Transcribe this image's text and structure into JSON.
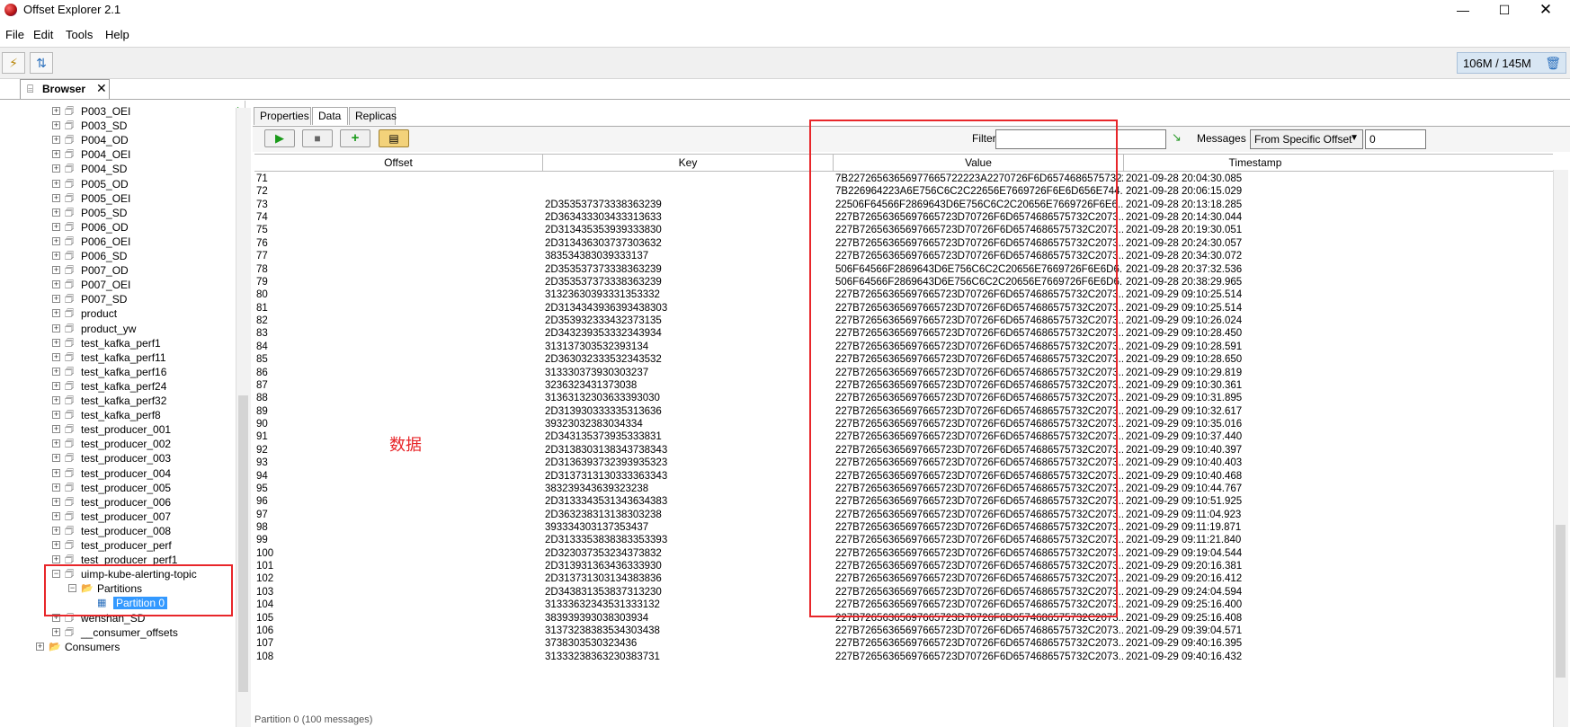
{
  "window": {
    "title": "Offset Explorer  2.1",
    "controls": [
      "—",
      "☐",
      "✕"
    ]
  },
  "menu": [
    "File",
    "Edit",
    "Tools",
    "Help"
  ],
  "memory": "106M / 145M",
  "browser_tab": {
    "label": "Browser",
    "close": "✕"
  },
  "tree": [
    {
      "label": "P003_OEI",
      "level": 1
    },
    {
      "label": "P003_SD",
      "level": 1
    },
    {
      "label": "P004_OD",
      "level": 1
    },
    {
      "label": "P004_OEI",
      "level": 1
    },
    {
      "label": "P004_SD",
      "level": 1
    },
    {
      "label": "P005_OD",
      "level": 1
    },
    {
      "label": "P005_OEI",
      "level": 1
    },
    {
      "label": "P005_SD",
      "level": 1
    },
    {
      "label": "P006_OD",
      "level": 1
    },
    {
      "label": "P006_OEI",
      "level": 1
    },
    {
      "label": "P006_SD",
      "level": 1
    },
    {
      "label": "P007_OD",
      "level": 1
    },
    {
      "label": "P007_OEI",
      "level": 1
    },
    {
      "label": "P007_SD",
      "level": 1
    },
    {
      "label": "product",
      "level": 1
    },
    {
      "label": "product_yw",
      "level": 1
    },
    {
      "label": "test_kafka_perf1",
      "level": 1
    },
    {
      "label": "test_kafka_perf11",
      "level": 1
    },
    {
      "label": "test_kafka_perf16",
      "level": 1
    },
    {
      "label": "test_kafka_perf24",
      "level": 1
    },
    {
      "label": "test_kafka_perf32",
      "level": 1
    },
    {
      "label": "test_kafka_perf8",
      "level": 1
    },
    {
      "label": "test_producer_001",
      "level": 1
    },
    {
      "label": "test_producer_002",
      "level": 1
    },
    {
      "label": "test_producer_003",
      "level": 1
    },
    {
      "label": "test_producer_004",
      "level": 1
    },
    {
      "label": "test_producer_005",
      "level": 1
    },
    {
      "label": "test_producer_006",
      "level": 1
    },
    {
      "label": "test_producer_007",
      "level": 1
    },
    {
      "label": "test_producer_008",
      "level": 1
    },
    {
      "label": "test_producer_perf",
      "level": 1
    },
    {
      "label": "test_producer_perf1",
      "level": 1
    },
    {
      "label": "uimp-kube-alerting-topic",
      "level": 1,
      "expanded": true
    },
    {
      "label": "Partitions",
      "level": 2,
      "expanded": true,
      "folder": true
    },
    {
      "label": "Partition 0",
      "level": 3,
      "selected": true,
      "leaf": true
    },
    {
      "label": "wenshan_SD",
      "level": 1
    },
    {
      "label": "__consumer_offsets",
      "level": 1
    },
    {
      "label": "Consumers",
      "level": 0,
      "folder": true
    }
  ],
  "data_panel": {
    "tabs": [
      "Properties",
      "Data",
      "Replicas"
    ],
    "active_tab": "Data",
    "filter_label": "Filter",
    "filter_value": "",
    "messages_label": "Messages",
    "messages_mode": "From Specific Offset",
    "offset_value": "0",
    "annotation": "数据",
    "status_text": "Partition 0 (100 messages)",
    "columns": [
      "Offset",
      "Key",
      "Value",
      "Timestamp"
    ],
    "rows": [
      [
        "71",
        "",
        "7B22726563656977665722223A2270726F6D657468657573222...",
        "2021-09-28 20:04:30.085"
      ],
      [
        "72",
        "",
        "7B226964223A6E756C6C2C22656E7669726F6E6D656E744...",
        "2021-09-28 20:06:15.029"
      ],
      [
        "73",
        "2D353537373338363239",
        "22506F64566F2869643D6E756C6C2C20656E7669726F6E6...",
        "2021-09-28 20:13:18.285"
      ],
      [
        "74",
        "2D363433303433313633",
        "227B72656365697665723D70726F6D6574686575732C2073...",
        "2021-09-28 20:14:30.044"
      ],
      [
        "75",
        "2D313435353939333830",
        "227B72656365697665723D70726F6D6574686575732C2073...",
        "2021-09-28 20:19:30.051"
      ],
      [
        "76",
        "2D313436303737303632",
        "227B72656365697665723D70726F6D6574686575732C2073...",
        "2021-09-28 20:24:30.057"
      ],
      [
        "77",
        "383534383039333137",
        "227B72656365697665723D70726F6D6574686575732C2073...",
        "2021-09-28 20:34:30.072"
      ],
      [
        "78",
        "2D353537373338363239",
        "506F64566F2869643D6E756C6C2C20656E7669726F6E6D6...",
        "2021-09-28 20:37:32.536"
      ],
      [
        "79",
        "2D353537373338363239",
        "506F64566F2869643D6E756C6C2C20656E7669726F6E6D6...",
        "2021-09-28 20:38:29.965"
      ],
      [
        "80",
        "31323630393331353332",
        "227B72656365697665723D70726F6D6574686575732C2073...",
        "2021-09-29 09:10:25.514"
      ],
      [
        "81",
        "2D3134343936393438303",
        "227B72656365697665723D70726F6D6574686575732C2073...",
        "2021-09-29 09:10:25.514"
      ],
      [
        "82",
        "2D353932333432373135",
        "227B72656365697665723D70726F6D6574686575732C2073...",
        "2021-09-29 09:10:26.024"
      ],
      [
        "83",
        "2D343239353332343934",
        "227B72656365697665723D70726F6D6574686575732C2073...",
        "2021-09-29 09:10:28.450"
      ],
      [
        "84",
        "313137303532393134",
        "227B72656365697665723D70726F6D6574686575732C2073...",
        "2021-09-29 09:10:28.591"
      ],
      [
        "85",
        "2D363032333532343532",
        "227B72656365697665723D70726F6D6574686575732C2073...",
        "2021-09-29 09:10:28.650"
      ],
      [
        "86",
        "313330373930303237",
        "227B72656365697665723D70726F6D6574686575732C2073...",
        "2021-09-29 09:10:29.819"
      ],
      [
        "87",
        "3236323431373038",
        "227B72656365697665723D70726F6D6574686575732C2073...",
        "2021-09-29 09:10:30.361"
      ],
      [
        "88",
        "31363132303633393030",
        "227B72656365697665723D70726F6D6574686575732C2073...",
        "2021-09-29 09:10:31.895"
      ],
      [
        "89",
        "2D313930333335313636",
        "227B72656365697665723D70726F6D6574686575732C2073...",
        "2021-09-29 09:10:32.617"
      ],
      [
        "90",
        "39323032383034334",
        "227B72656365697665723D70726F6D6574686575732C2073...",
        "2021-09-29 09:10:35.016"
      ],
      [
        "91",
        "2D343135373935333831",
        "227B72656365697665723D70726F6D6574686575732C2073...",
        "2021-09-29 09:10:37.440"
      ],
      [
        "92",
        "2D3138303138343738343",
        "227B72656365697665723D70726F6D6574686575732C2073...",
        "2021-09-29 09:10:40.397"
      ],
      [
        "93",
        "2D3136393732393935323",
        "227B72656365697665723D70726F6D6574686575732C2073...",
        "2021-09-29 09:10:40.403"
      ],
      [
        "94",
        "2D3137313130333363343",
        "227B72656365697665723D70726F6D6574686575732C2073...",
        "2021-09-29 09:10:40.468"
      ],
      [
        "95",
        "383239343639323238",
        "227B72656365697665723D70726F6D6574686575732C2073...",
        "2021-09-29 09:10:44.767"
      ],
      [
        "96",
        "2D3133343531343634383",
        "227B72656365697665723D70726F6D6574686575732C2073...",
        "2021-09-29 09:10:51.925"
      ],
      [
        "97",
        "2D363238313138303238",
        "227B72656365697665723D70726F6D6574686575732C2073...",
        "2021-09-29 09:11:04.923"
      ],
      [
        "98",
        "393334303137353437",
        "227B72656365697665723D70726F6D6574686575732C2073...",
        "2021-09-29 09:11:19.871"
      ],
      [
        "99",
        "2D3133353838383353393",
        "227B72656365697665723D70726F6D6574686575732C2073...",
        "2021-09-29 09:11:21.840"
      ],
      [
        "100",
        "2D323037353234373832",
        "227B72656365697665723D70726F6D6574686575732C2073...",
        "2021-09-29 09:19:04.544"
      ],
      [
        "101",
        "2D313931363436333930",
        "227B72656365697665723D70726F6D6574686575732C2073...",
        "2021-09-29 09:20:16.381"
      ],
      [
        "102",
        "2D313731303134383836",
        "227B72656365697665723D70726F6D6574686575732C2073...",
        "2021-09-29 09:20:16.412"
      ],
      [
        "103",
        "2D343831353837313230",
        "227B72656365697665723D70726F6D6574686575732C2073...",
        "2021-09-29 09:24:04.594"
      ],
      [
        "104",
        "31333632343531333132",
        "227B72656365697665723D70726F6D6574686575732C2073...",
        "2021-09-29 09:25:16.400"
      ],
      [
        "105",
        "383939393038303934",
        "227B72656365697665723D70726F6D6574686575732C2073...",
        "2021-09-29 09:25:16.408"
      ],
      [
        "106",
        "31373238383534303438",
        "227B72656365697665723D70726F6D6574686575732C2073...",
        "2021-09-29 09:39:04.571"
      ],
      [
        "107",
        "3738303530323436",
        "227B72656365697665723D70726F6D6574686575732C2073...",
        "2021-09-29 09:40:16.395"
      ],
      [
        "108",
        "31333238363230383731",
        "227B72656365697665723D70726F6D6574686575732C2073...",
        "2021-09-29 09:40:16.432"
      ]
    ]
  },
  "colors": {
    "highlight_red": "#e8262a",
    "selection_blue": "#3399ff",
    "toolbar_bg": "#f0f0f0"
  }
}
